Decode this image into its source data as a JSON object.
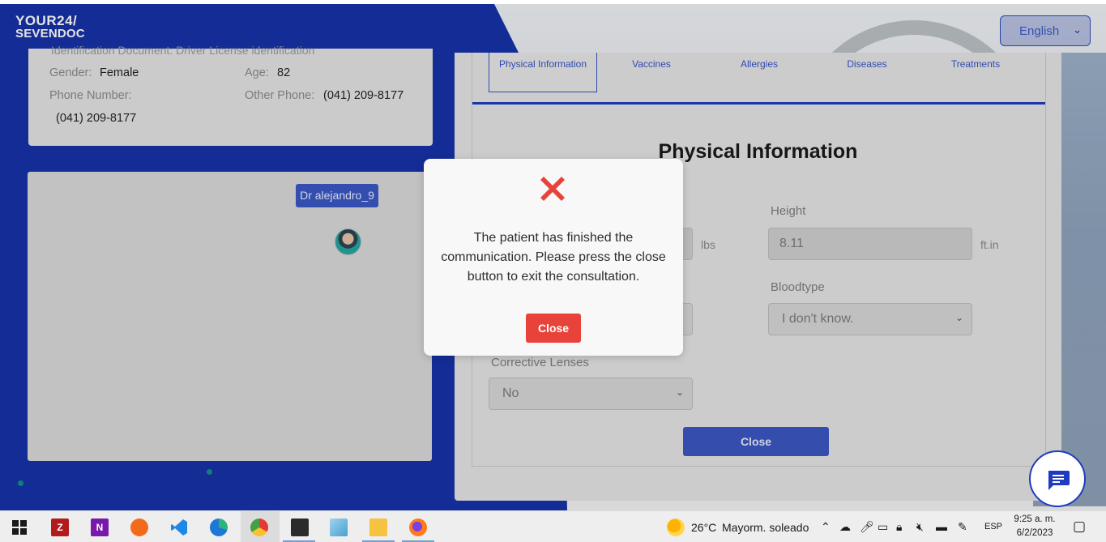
{
  "app": {
    "logo_line1": "YOUR24/",
    "logo_line2": "SEVENDOC",
    "language": "English"
  },
  "patient_info": {
    "cut_text": "Identification Document:  Driver License identification",
    "gender_label": "Gender:",
    "gender_value": "Female",
    "age_label": "Age:",
    "age_value": "82",
    "phone_label": "Phone Number:",
    "phone_value": "(041) 209-8177",
    "other_phone_label": "Other Phone:",
    "other_phone_value": "(041) 209-8177"
  },
  "chat": {
    "doctor_badge": "Dr alejandro_9"
  },
  "tabs": [
    {
      "label": "Physical Information",
      "active": true
    },
    {
      "label": "Vaccines",
      "active": false
    },
    {
      "label": "Allergies",
      "active": false
    },
    {
      "label": "Diseases",
      "active": false
    },
    {
      "label": "Treatments",
      "active": false
    }
  ],
  "physical": {
    "title": "Physical Information",
    "weight_unit": "lbs",
    "height_label": "Height",
    "height_value": "8.11",
    "height_unit": "ft.in",
    "bloodtype_label": "Bloodtype",
    "bloodtype_value": "I don't know.",
    "lenses_label": "Corrective Lenses",
    "lenses_value": "No",
    "close_label": "Close"
  },
  "modal": {
    "message": "The patient has finished the communication. Please press the close button to exit the consultation.",
    "close_label": "Close",
    "icon": "close-icon",
    "icon_color": "#e8433a"
  },
  "taskbar": {
    "weather_temp": "26°C",
    "weather_text": "Mayorm. soleado",
    "language": "ESP",
    "time": "9:25 a. m.",
    "date": "6/2/2023"
  },
  "colors": {
    "brand_blue": "#1733a8",
    "accent_blue": "#3553c4",
    "danger_red": "#e8433a"
  }
}
